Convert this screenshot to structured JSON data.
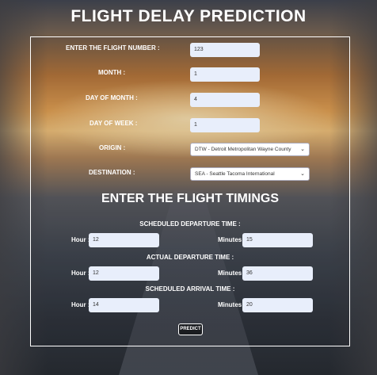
{
  "title": "FLIGHT DELAY PREDICTION",
  "form": {
    "flight_number": {
      "label": "ENTER THE FLIGHT NUMBER :",
      "value": "123"
    },
    "month": {
      "label": "MONTH :",
      "value": "1"
    },
    "day_of_month": {
      "label": "DAY OF MONTH :",
      "value": "4"
    },
    "day_of_week": {
      "label": "DAY OF WEEK :",
      "value": "1"
    },
    "origin": {
      "label": "ORIGIN :",
      "value": "DTW - Detroit Metropolitan Wayne County"
    },
    "destination": {
      "label": "DESTINATION :",
      "value": "SEA - Seattle Tacoma International"
    }
  },
  "timings": {
    "heading": "ENTER THE FLIGHT TIMINGS",
    "scheduled_departure": {
      "heading": "SCHEDULED DEPARTURE TIME :",
      "hour_label": "Hour :",
      "hour": "12",
      "minutes_label": "Minutes :",
      "minutes": "15"
    },
    "actual_departure": {
      "heading": "ACTUAL DEPARTURE TIME :",
      "hour_label": "Hour :",
      "hour": "12",
      "minutes_label": "Minutes :",
      "minutes": "36"
    },
    "scheduled_arrival": {
      "heading": "SCHEDULED ARRIVAL TIME :",
      "hour_label": "Hour :",
      "hour": "14",
      "minutes_label": "Minutes :",
      "minutes": "20"
    }
  },
  "predict_label": "PREDICT"
}
